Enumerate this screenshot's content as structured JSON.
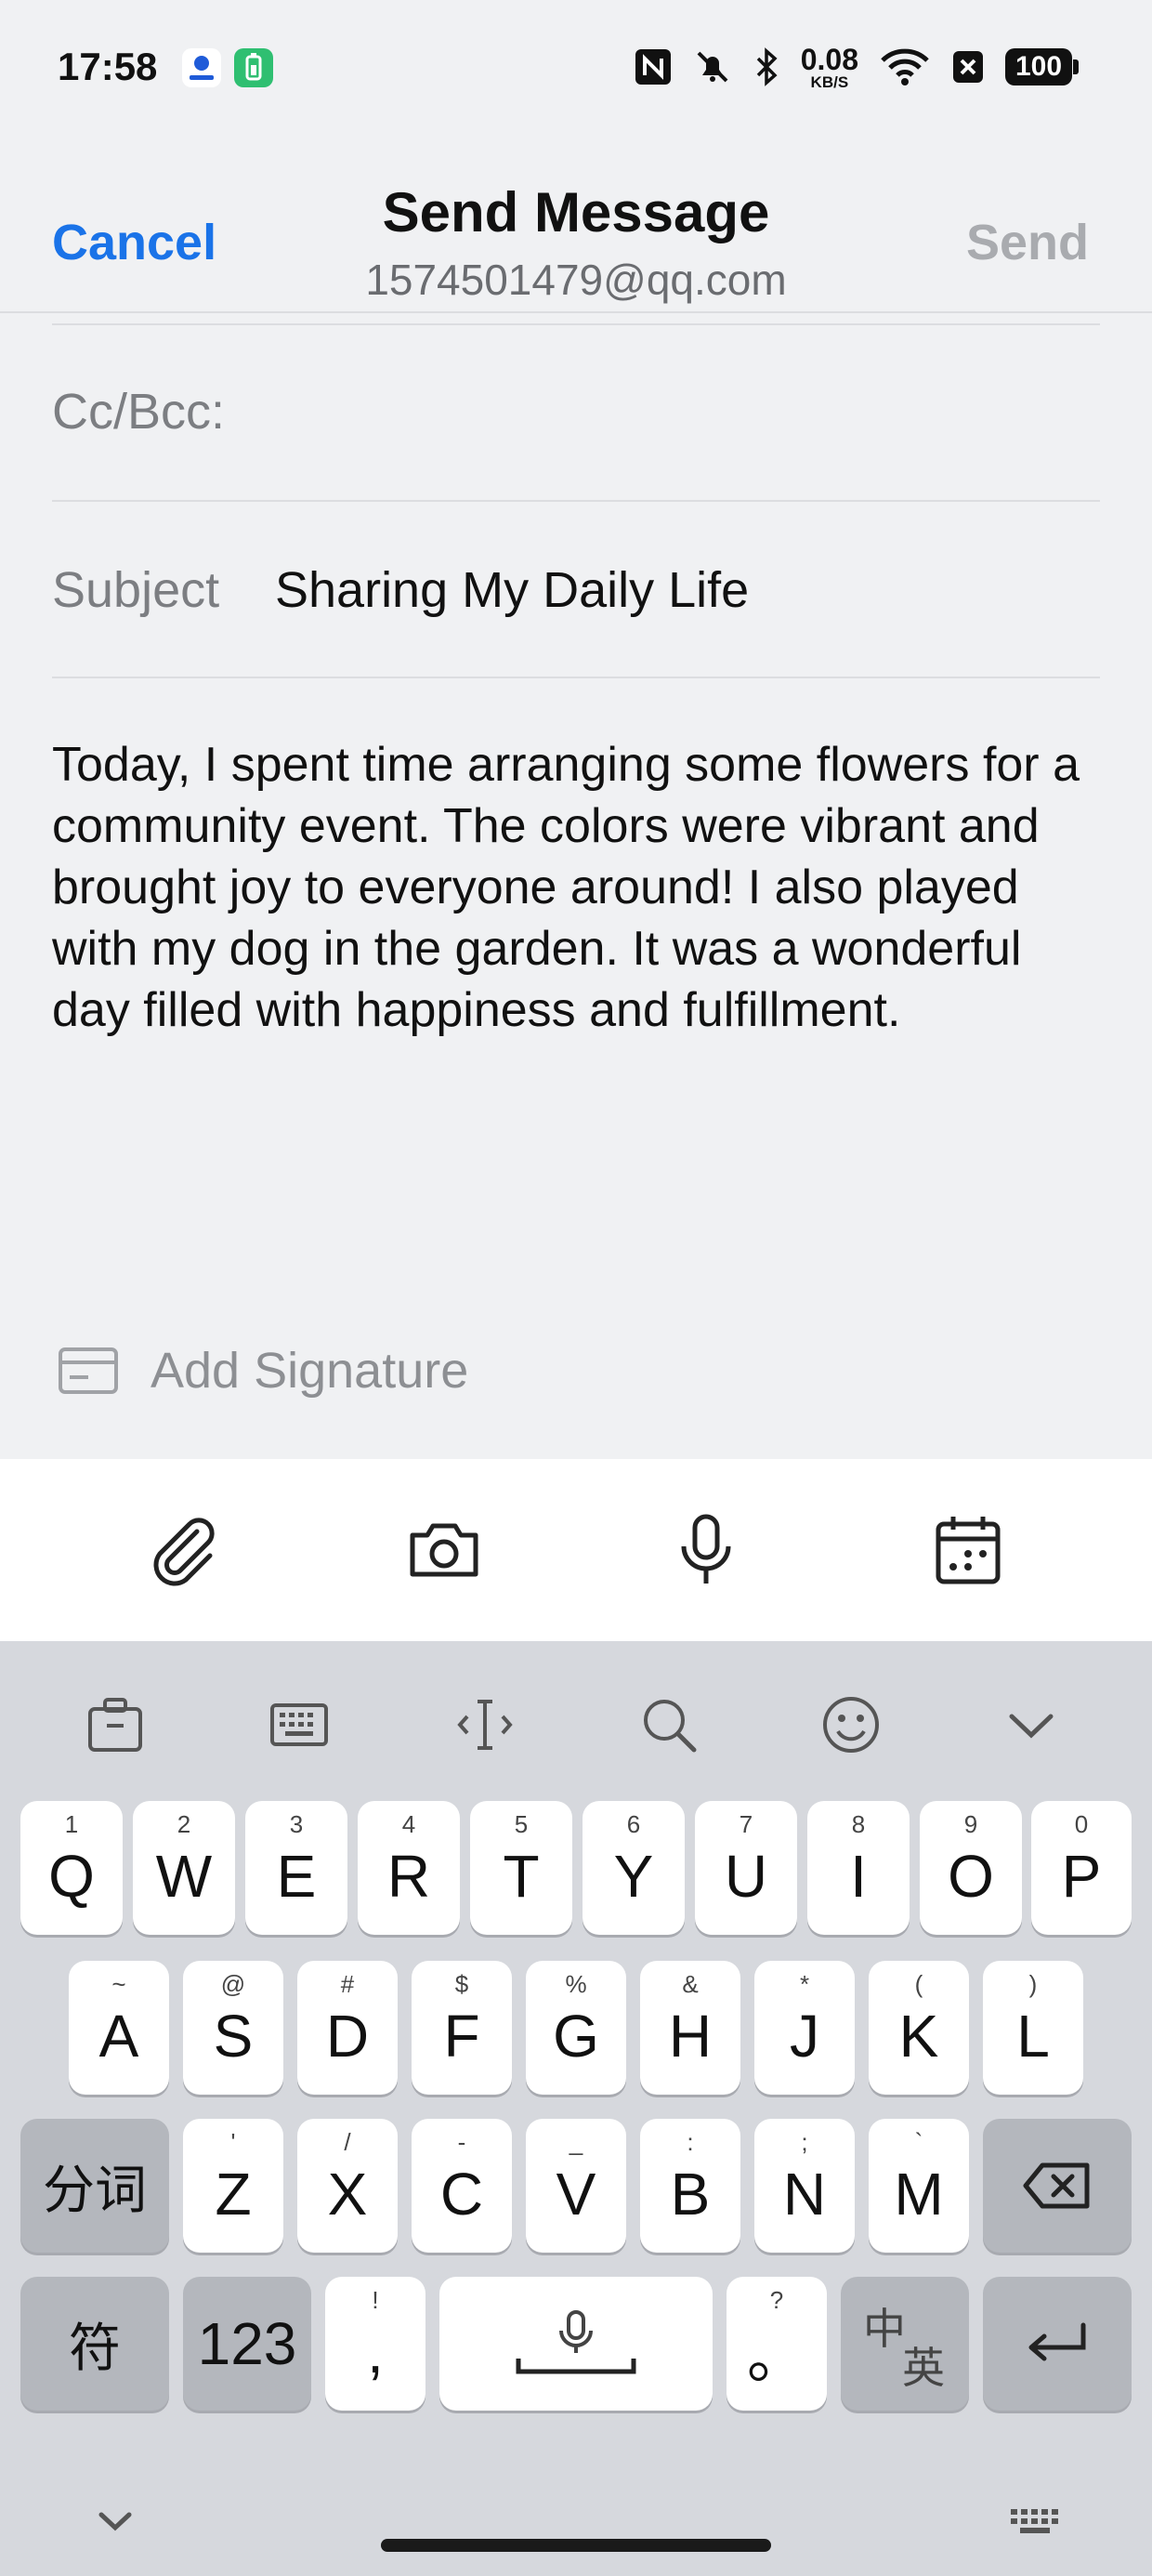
{
  "status_bar": {
    "time": "17:58",
    "net_speed_value": "0.08",
    "net_speed_unit": "KB/S",
    "battery": "100",
    "icons": [
      "app-icon-blue",
      "battery-saver-icon",
      "nfc-icon",
      "mute-icon",
      "bluetooth-icon",
      "wifi-icon",
      "sim-icon"
    ]
  },
  "header": {
    "cancel_label": "Cancel",
    "title": "Send Message",
    "subtitle": "1574501479@qq.com",
    "send_label": "Send"
  },
  "compose": {
    "cc_label": "Cc/Bcc:",
    "subject_label": "Subject",
    "subject_value": "Sharing My Daily Life",
    "body": "Today, I spent time arranging some flowers for a community event. The colors were vibrant and brought joy to everyone around! I also played with my dog in the garden. It was a wonderful day filled with happiness and fulfillment.",
    "signature_label": "Add Signature"
  },
  "toolbar": {
    "icons": [
      "paperclip-icon",
      "camera-icon",
      "microphone-icon",
      "calendar-icon"
    ]
  },
  "keyboard": {
    "tool_icons": [
      "clipboard-icon",
      "keyboard-icon",
      "cursor-icon",
      "search-icon",
      "emoji-icon",
      "collapse-icon"
    ],
    "row1": [
      {
        "key": "Q",
        "hint": "1"
      },
      {
        "key": "W",
        "hint": "2"
      },
      {
        "key": "E",
        "hint": "3"
      },
      {
        "key": "R",
        "hint": "4"
      },
      {
        "key": "T",
        "hint": "5"
      },
      {
        "key": "Y",
        "hint": "6"
      },
      {
        "key": "U",
        "hint": "7"
      },
      {
        "key": "I",
        "hint": "8"
      },
      {
        "key": "O",
        "hint": "9"
      },
      {
        "key": "P",
        "hint": "0"
      }
    ],
    "row2": [
      {
        "key": "A",
        "hint": "~"
      },
      {
        "key": "S",
        "hint": "@"
      },
      {
        "key": "D",
        "hint": "#"
      },
      {
        "key": "F",
        "hint": "$"
      },
      {
        "key": "G",
        "hint": "%"
      },
      {
        "key": "H",
        "hint": "&"
      },
      {
        "key": "J",
        "hint": "*"
      },
      {
        "key": "K",
        "hint": "("
      },
      {
        "key": "L",
        "hint": ")"
      }
    ],
    "row3": [
      {
        "key": "Z",
        "hint": "'"
      },
      {
        "key": "X",
        "hint": "/"
      },
      {
        "key": "C",
        "hint": "-"
      },
      {
        "key": "V",
        "hint": "_"
      },
      {
        "key": "B",
        "hint": ":"
      },
      {
        "key": "N",
        "hint": ";"
      },
      {
        "key": "M",
        "hint": "`"
      }
    ],
    "segment_label": "分词",
    "symbol_label": "符",
    "number_label": "123",
    "comma_key": ",",
    "comma_hint": "!",
    "period_key": "。",
    "period_hint": "?",
    "lang_primary": "中",
    "lang_secondary": "英"
  }
}
